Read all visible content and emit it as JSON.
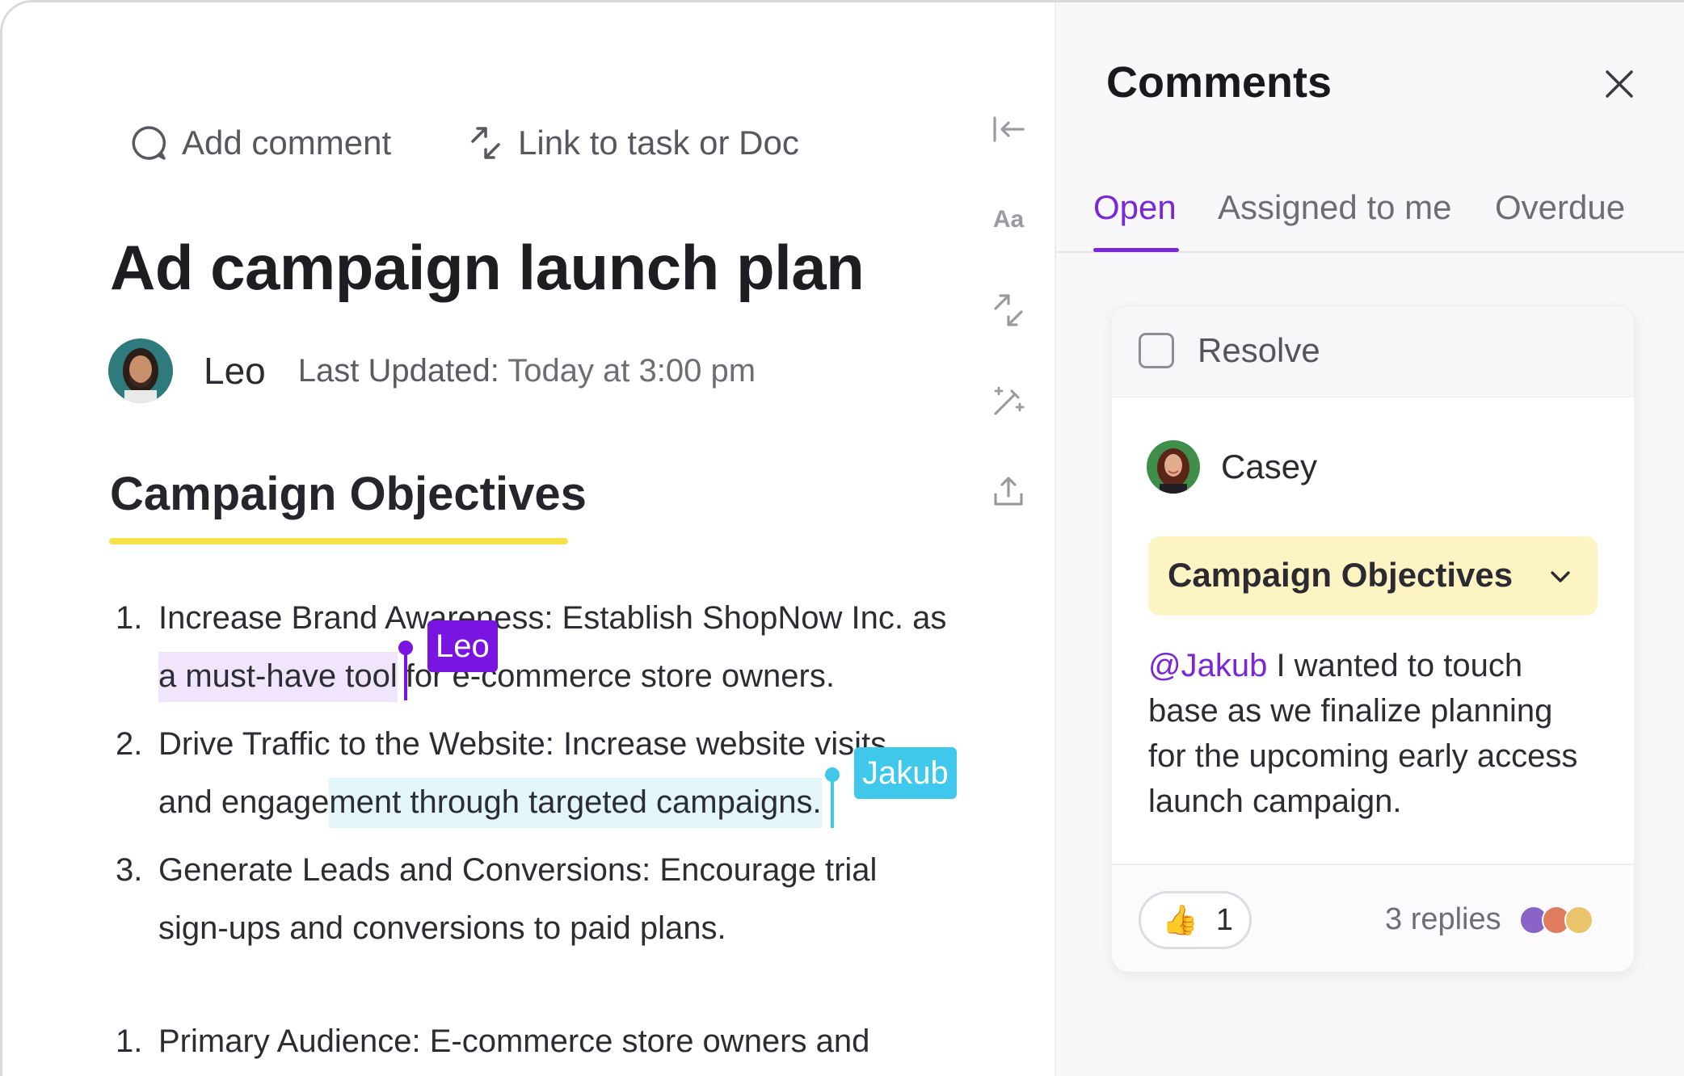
{
  "doc": {
    "actions": {
      "add_comment": "Add comment",
      "link_task": "Link to task or Doc"
    },
    "title": "Ad campaign launch plan",
    "author": {
      "name": "Leo",
      "last_updated_label": "Last Updated:",
      "last_updated_value": "Today at 3:00 pm"
    },
    "section_heading": "Campaign Objectives",
    "objectives": [
      {
        "num": "1.",
        "line1": "Increase Brand Awareness: Establish ShopNow Inc. as",
        "line2_hl": "a must-have tool",
        "line2_rest": "for e-commerce store owners."
      },
      {
        "num": "2.",
        "line1": "Drive Traffic to the Website: Increase website visits",
        "line2_pre": "and engage",
        "line2_hl": "ment through targeted campaigns."
      },
      {
        "num": "3.",
        "line1": "Generate Leads and Conversions: Encourage trial",
        "line2": "sign-ups and conversions to paid plans."
      }
    ],
    "audience": {
      "num": "1.",
      "text": "Primary Audience: E-commerce store owners and"
    },
    "cursors": [
      {
        "name": "Leo",
        "color": "#7a14e0"
      },
      {
        "name": "Jakub",
        "color": "#3fc8ec"
      }
    ],
    "highlight_colors": {
      "purple": "#f1e5fd",
      "cyan": "#e3f7fb",
      "heading_underline": "#f6e04c"
    }
  },
  "rail": {
    "text_format": "Aa",
    "icons": [
      "collapse-icon",
      "text-format-icon",
      "link-icon",
      "magic-wand-icon",
      "export-icon"
    ]
  },
  "comments": {
    "title": "Comments",
    "tabs": [
      "Open",
      "Assigned to me",
      "Overdue"
    ],
    "active_tab": "Open",
    "accent": "#7a26d9",
    "card": {
      "resolve_label": "Resolve",
      "commenter": "Casey",
      "reference": "Campaign Objectives",
      "mention": "@Jakub",
      "body_line1_rest": " I wanted to touch",
      "body_line2": "base as we finalize planning",
      "body_line3": "for the upcoming early access",
      "body_line4": "launch campaign.",
      "reaction_emoji": "👍",
      "reaction_count": "1",
      "replies": "3 replies"
    }
  }
}
